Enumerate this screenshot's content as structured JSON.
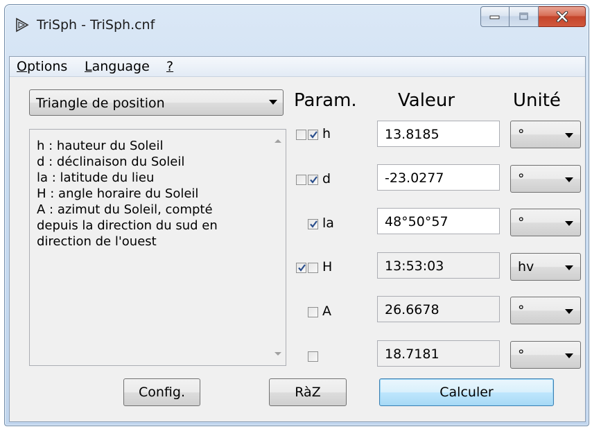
{
  "window": {
    "title": "TriSph - TriSph.cnf"
  },
  "menu": [
    {
      "label": "Options",
      "mnemonic": "O",
      "rest": "ptions"
    },
    {
      "label": "Language",
      "mnemonic": "L",
      "rest": "anguage"
    },
    {
      "label": "?",
      "mnemonic": "?",
      "rest": ""
    }
  ],
  "mode_select": {
    "value": "Triangle de position"
  },
  "description": [
    "h : hauteur du Soleil",
    "d : déclinaison du Soleil",
    "la : latitude du lieu",
    "H : angle horaire du Soleil",
    "A : azimut du Soleil, compté",
    "depuis la direction du sud en",
    "direction de l'ouest"
  ],
  "headers": {
    "param": "Param.",
    "value": "Valeur",
    "unit": "Unité"
  },
  "params": [
    {
      "label": "h",
      "value": "13.8185",
      "unit": "°",
      "editable": true,
      "checks": [
        false,
        true
      ]
    },
    {
      "label": "d",
      "value": "-23.0277",
      "unit": "°",
      "editable": true,
      "checks": [
        false,
        true
      ]
    },
    {
      "label": "la",
      "value": "48°50°57",
      "unit": "°",
      "editable": true,
      "checks": [
        true
      ]
    },
    {
      "label": "H",
      "value": "13:53:03",
      "unit": "hv",
      "editable": false,
      "checks": [
        true,
        false
      ]
    },
    {
      "label": "A",
      "value": "26.6678",
      "unit": "°",
      "editable": false,
      "checks": [
        false
      ]
    },
    {
      "label": "",
      "value": "18.7181",
      "unit": "°",
      "editable": false,
      "checks": [
        false
      ]
    }
  ],
  "buttons": {
    "config": "Config.",
    "reset": "RàZ",
    "compute": "Calculer"
  }
}
